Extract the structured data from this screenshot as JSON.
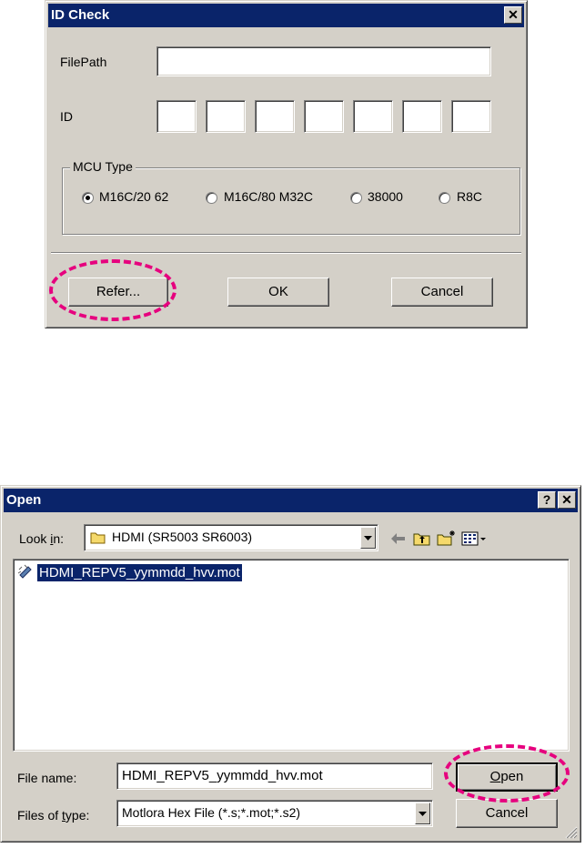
{
  "idcheck": {
    "title": "ID Check",
    "close_glyph": "✕",
    "filepath_label": "FilePath",
    "filepath_value": "",
    "id_label": "ID",
    "id_fields": [
      "",
      "",
      "",
      "",
      "",
      "",
      ""
    ],
    "mcu_group_title": "MCU Type",
    "mcu_options": [
      {
        "label": "M16C/20 62",
        "checked": true
      },
      {
        "label": "M16C/80  M32C",
        "checked": false
      },
      {
        "label": "38000",
        "checked": false
      },
      {
        "label": "R8C",
        "checked": false
      }
    ],
    "refer_label": "Refer...",
    "ok_label": "OK",
    "cancel_label": "Cancel"
  },
  "open_dialog": {
    "title": "Open",
    "help_glyph": "?",
    "close_glyph": "✕",
    "lookin_label_pre": "Look ",
    "lookin_label_u": "i",
    "lookin_label_post": "n:",
    "lookin_value": "HDMI (SR5003 SR6003)",
    "files": [
      "HDMI_REPV5_yymmdd_hvv.mot"
    ],
    "filename_label": "File name:",
    "filename_value": "HDMI_REPV5_yymmdd_hvv.mot",
    "filetype_label_pre": "Files of ",
    "filetype_label_u": "t",
    "filetype_label_post": "ype:",
    "filetype_value": "Motlora Hex File (*.s;*.mot;*.s2)",
    "open_label_u": "O",
    "open_label_rest": "pen",
    "cancel_label": "Cancel"
  },
  "colors": {
    "titlebar": "#0a246a",
    "highlight": "#e6007e",
    "selection": "#0a246a"
  }
}
